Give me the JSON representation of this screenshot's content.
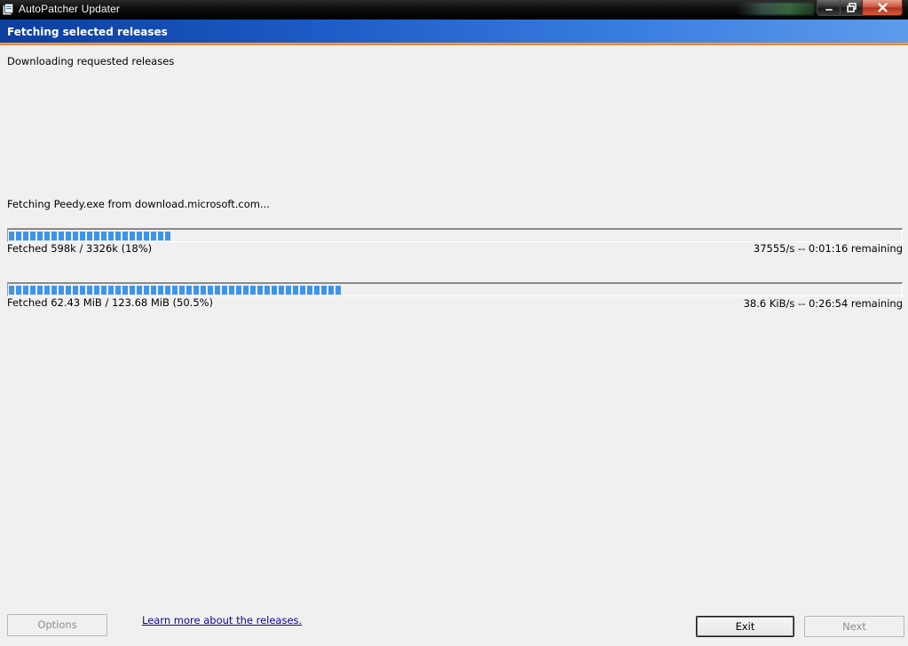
{
  "window": {
    "title": "AutoPatcher Updater",
    "accent": "#1d5bc6"
  },
  "header": {
    "title": "Fetching selected releases"
  },
  "content": {
    "status_message": "Downloading requested releases",
    "current_file": "Fetching Peedy.exe from download.microsoft.com..."
  },
  "progress": [
    {
      "fraction": 0.18,
      "left_text": "Fetched 598k / 3326k (18%)",
      "right_text": "37555/s -- 0:01:16 remaining",
      "color": "#3d95ea"
    },
    {
      "fraction": 0.375,
      "left_text": "Fetched 62.43 MiB / 123.68 MiB (50.5%)",
      "right_text": "38.6 KiB/s -- 0:26:54 remaining",
      "color": "#3d95ea"
    }
  ],
  "footer": {
    "options_label": "Options",
    "learn_more_link": "Learn more about the releases.",
    "exit_label": "Exit",
    "next_label": "Next"
  }
}
